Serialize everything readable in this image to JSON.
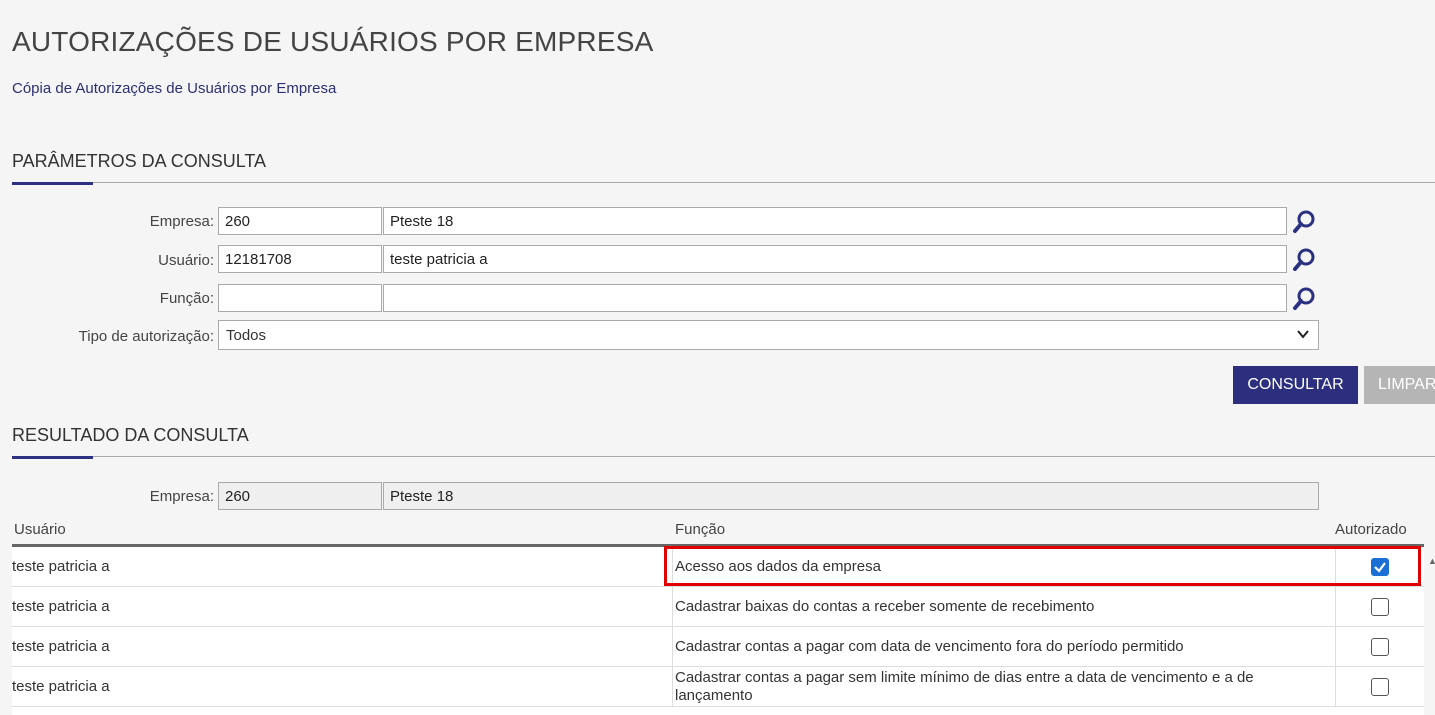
{
  "header": {
    "title": "AUTORIZAÇÕES DE USUÁRIOS POR EMPRESA",
    "subtitle": "Cópia de Autorizações de Usuários por Empresa"
  },
  "params": {
    "section_title": "PARÂMETROS DA CONSULTA",
    "empresa": {
      "label": "Empresa:",
      "code": "260",
      "name": "Pteste 18"
    },
    "usuario": {
      "label": "Usuário:",
      "code": "12181708",
      "name": "teste patricia a"
    },
    "funcao": {
      "label": "Função:",
      "code": "",
      "name": ""
    },
    "tipo": {
      "label": "Tipo de autorização:",
      "value": "Todos"
    },
    "buttons": {
      "consultar": "CONSULTAR",
      "limpar": "LIMPAR"
    }
  },
  "results": {
    "section_title": "RESULTADO DA CONSULTA",
    "empresa": {
      "label": "Empresa:",
      "code": "260",
      "name": "Pteste 18"
    },
    "columns": [
      "Usuário",
      "Função",
      "Autorizado"
    ],
    "rows": [
      {
        "usuario": "teste patricia a",
        "funcao": "Acesso aos dados da empresa",
        "autorizado": true
      },
      {
        "usuario": "teste patricia a",
        "funcao": "Cadastrar baixas do contas a receber somente de recebimento",
        "autorizado": false
      },
      {
        "usuario": "teste patricia a",
        "funcao": "Cadastrar contas a pagar com data de vencimento fora do período permitido",
        "autorizado": false
      },
      {
        "usuario": "teste patricia a",
        "funcao": "Cadastrar contas a pagar sem limite mínimo de dias entre a data de vencimento e a de lançamento",
        "autorizado": false
      }
    ]
  },
  "colors": {
    "accent": "#2b2f7d",
    "highlight": "#e00000",
    "checkbox": "#1a6fd4"
  },
  "icons": {
    "search": "search-icon",
    "dropdown": "chevron-down-icon",
    "check": "check-icon"
  }
}
